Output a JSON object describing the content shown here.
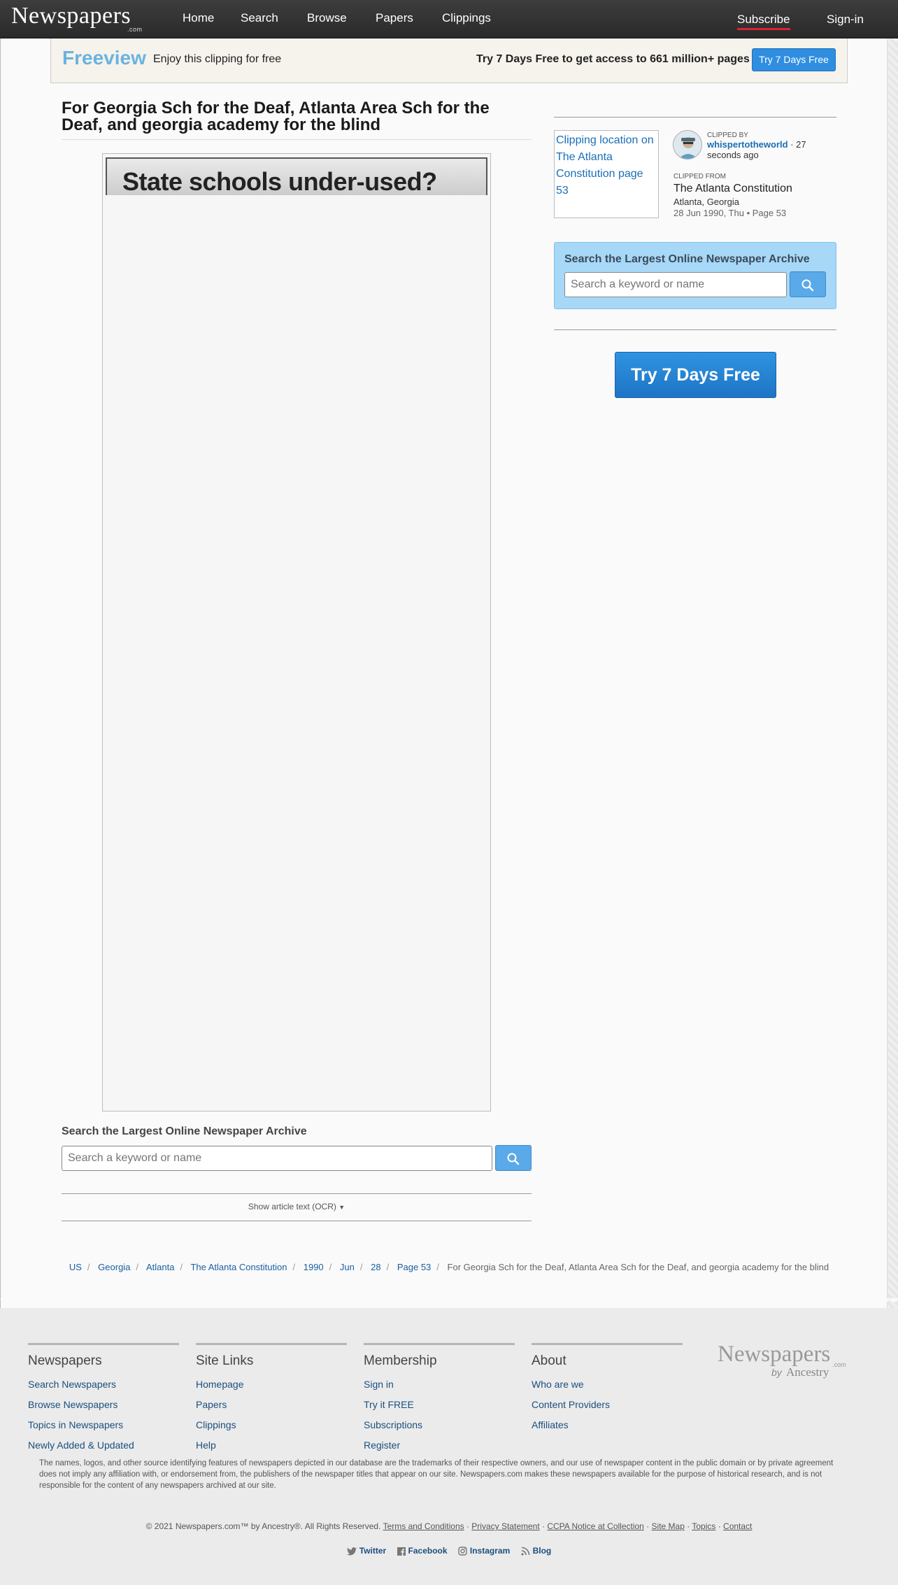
{
  "header": {
    "logo": "Newspapers",
    "logo_com": ".com",
    "nav": [
      "Home",
      "Search",
      "Browse",
      "Papers",
      "Clippings"
    ],
    "subscribe": "Subscribe",
    "signin": "Sign-in"
  },
  "freeview": {
    "title": "Freeview",
    "enjoy": "Enjoy this clipping for free",
    "try_text": "Try 7 Days Free to get access to 661 million+ pages",
    "button": "Try 7 Days Free"
  },
  "article": {
    "title": "For Georgia Sch for the Deaf, Atlanta Area Sch for the Deaf, and georgia academy for the blind",
    "clip_headline": "State schools under-used?"
  },
  "search_left": {
    "label": "Search the Largest Online Newspaper Archive",
    "placeholder": "Search a keyword or name"
  },
  "ocr_toggle": "Show article text (OCR)",
  "breadcrumb": [
    "US",
    "Georgia",
    "Atlanta",
    "The Atlanta Constitution",
    "1990",
    "Jun",
    "28",
    "Page 53"
  ],
  "breadcrumb_current": "For Georgia Sch for the Deaf, Atlanta Area Sch for the Deaf, and georgia academy for the blind",
  "sidebar": {
    "location_alt": "Clipping location on The Atlanta Constitution page 53",
    "clipped_by_label": "CLIPPED BY",
    "clipped_by_user": "whispertotheworld",
    "clipped_by_time": " · 27 seconds ago",
    "clipped_from_label": "CLIPPED FROM",
    "paper_name": "The Atlanta Constitution",
    "paper_location": "Atlanta, Georgia",
    "paper_date": "28 Jun 1990, Thu  •  Page 53",
    "search_label": "Search the Largest Online Newspaper Archive",
    "search_placeholder": "Search a keyword or name",
    "try_button": "Try 7 Days Free"
  },
  "footer": {
    "columns": [
      {
        "title": "Newspapers",
        "links": [
          "Search Newspapers",
          "Browse Newspapers",
          "Topics in Newspapers",
          "Newly Added & Updated"
        ]
      },
      {
        "title": "Site Links",
        "links": [
          "Homepage",
          "Papers",
          "Clippings",
          "Help"
        ]
      },
      {
        "title": "Membership",
        "links": [
          "Sign in",
          "Try it FREE",
          "Subscriptions",
          "Register"
        ]
      },
      {
        "title": "About",
        "links": [
          "Who are we",
          "Content Providers",
          "Affiliates"
        ]
      }
    ],
    "logo": "Newspapers",
    "logo_com": ".com",
    "logo_by": "by",
    "logo_ancestry": "Ancestry",
    "disclaimer": "The names, logos, and other source identifying features of newspapers depicted in our database are the trademarks of their respective owners, and our use of newspaper content in the public domain or by private agreement does not imply any affiliation with, or endorsement from, the publishers of the newspaper titles that appear on our site. Newspapers.com makes these newspapers available for the purpose of historical research, and is not responsible for the content of any newspapers archived at our site.",
    "copyright": "© 2021 Newspapers.com™ by Ancestry®. All Rights Reserved.",
    "legal_links": [
      "Terms and Conditions",
      "Privacy Statement",
      "CCPA Notice at Collection",
      "Site Map",
      "Topics",
      "Contact"
    ],
    "social": [
      "Twitter",
      "Facebook",
      "Instagram",
      "Blog"
    ]
  },
  "colors": {
    "accent": "#2f8ee0",
    "freeview": "#6ab3e0",
    "search_panel": "#a8d8f7"
  }
}
